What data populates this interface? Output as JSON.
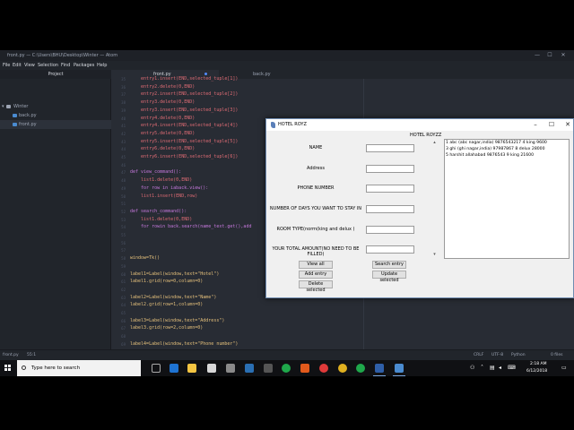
{
  "atom": {
    "window_title": "front.py — C:\\Users\\BHU\\Desktop\\Winter — Atom",
    "menu": [
      "File",
      "Edit",
      "View",
      "Selection",
      "Find",
      "Packages",
      "Help"
    ],
    "tree_header": "Project",
    "tree": [
      {
        "label": "Winter",
        "type": "folder"
      },
      {
        "label": "back.py",
        "type": "file"
      },
      {
        "label": "front.py",
        "type": "file",
        "selected": true
      }
    ],
    "tabs": [
      {
        "label": "front.py",
        "active": true,
        "modified": true
      },
      {
        "label": "back.py",
        "active": false,
        "modified": false
      }
    ],
    "code": [
      {
        "n": "35",
        "text": "    entry1.insert(END,selected_tuple[1])"
      },
      {
        "n": "36",
        "text": "    entry2.delete(0,END)"
      },
      {
        "n": "37",
        "text": "    entry2.insert(END,selected_tuple[2])"
      },
      {
        "n": "38",
        "text": "    entry3.delete(0,END)"
      },
      {
        "n": "39",
        "text": "    entry3.insert(END,selected_tuple[3])"
      },
      {
        "n": "40",
        "text": "    entry4.delete(0,END)"
      },
      {
        "n": "41",
        "text": "    entry4.insert(END,selected_tuple[4])"
      },
      {
        "n": "42",
        "text": "    entry5.delete(0,END)"
      },
      {
        "n": "43",
        "text": "    entry5.insert(END,selected_tuple[5])"
      },
      {
        "n": "44",
        "text": "    entry6.delete(0,END)"
      },
      {
        "n": "45",
        "text": "    entry6.insert(END,selected_tuple[6])"
      },
      {
        "n": "46",
        "text": ""
      },
      {
        "n": "47",
        "text": "def view_command():"
      },
      {
        "n": "48",
        "text": "    list1.delete(0,END)"
      },
      {
        "n": "49",
        "text": "    for row in iaback.view():"
      },
      {
        "n": "50",
        "text": "    list1.insert(END,row)"
      },
      {
        "n": "51",
        "text": ""
      },
      {
        "n": "52",
        "text": "def search_command():"
      },
      {
        "n": "53",
        "text": "    list1.delete(0,END)"
      },
      {
        "n": "54",
        "text": "    for rowin back.search(name_text.get(),add"
      },
      {
        "n": "55",
        "text": ""
      },
      {
        "n": "56",
        "text": ""
      },
      {
        "n": "57",
        "text": ""
      },
      {
        "n": "58",
        "text": "window=Tk()"
      },
      {
        "n": "59",
        "text": ""
      },
      {
        "n": "60",
        "text": "label1=Label(window,text=\"Hotel\")"
      },
      {
        "n": "61",
        "text": "label1.grid(row=0,column=0)"
      },
      {
        "n": "62",
        "text": ""
      },
      {
        "n": "63",
        "text": "label2=Label(window,text=\"Name\")"
      },
      {
        "n": "64",
        "text": "label2.grid(row=1,column=0)"
      },
      {
        "n": "65",
        "text": ""
      },
      {
        "n": "66",
        "text": "label3=Label(window,text=\"Address\")"
      },
      {
        "n": "67",
        "text": "label3.grid(row=2,column=0)"
      },
      {
        "n": "68",
        "text": ""
      },
      {
        "n": "69",
        "text": "label4=Label(window,text=\"Phone number\")"
      },
      {
        "n": "70",
        "text": "label4.grid(row=3,column=0)"
      }
    ],
    "status": {
      "file": "front.py",
      "position": "55:1",
      "line_ending": "CRLF",
      "encoding": "UTF-8",
      "grammar": "Python",
      "files": "0 files"
    }
  },
  "tk": {
    "title": "HOTEL ROYZ",
    "heading": "HOTEL ROYZZ",
    "fields": [
      {
        "label": "NAME",
        "value": ""
      },
      {
        "label": "Address",
        "value": ""
      },
      {
        "label": "PHONE NUMBER",
        "value": ""
      },
      {
        "label": "NUMBER OF DAYS YOU WANT TO STAY IN",
        "value": ""
      },
      {
        "label": "ROOM TYPE(norm(king and delux )",
        "value": ""
      },
      {
        "label": "YOUR TOTAL AMOUNT(NO NEED TO BE FILLED)",
        "value": ""
      }
    ],
    "list_items": [
      "1 abc (abc nagar,india) 9876543217 4 king 9600",
      "3 ghi (ghi nagar,india) 97987867 8 delux 28000",
      "5 harshit allahabad 9876543 9 king 21600"
    ],
    "buttons": {
      "view_all": "View all",
      "search": "Search entry",
      "add": "Add entry",
      "update": "Update selected",
      "delete": "Delete selected"
    }
  },
  "taskbar": {
    "search_placeholder": "Type here to search",
    "time": "2:18 AM",
    "date": "6/12/2018"
  }
}
